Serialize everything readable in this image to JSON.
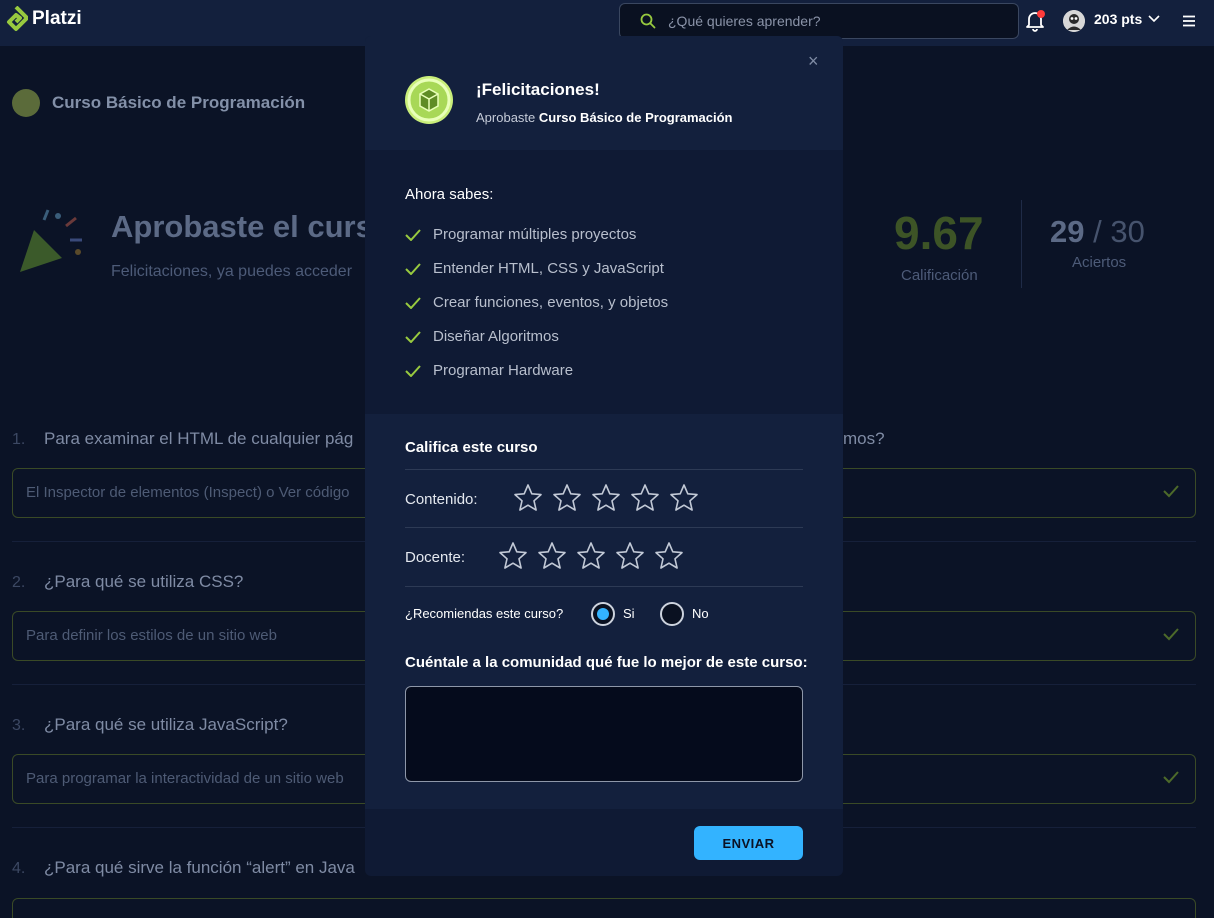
{
  "brand": {
    "name": "Platzi",
    "accent": "#98ca3f"
  },
  "search": {
    "placeholder": "¿Qué quieres aprender?"
  },
  "user": {
    "points": "203 pts"
  },
  "page": {
    "course_title": "Curso Básico de Programación",
    "approved_title": "Aprobaste el curso",
    "approved_sub": "Felicitaciones, ya puedes acceder",
    "score": "9.67",
    "score_label": "Calificación",
    "aciertos_value": "29",
    "aciertos_total": " / 30",
    "aciertos_label": "Aciertos",
    "questions": [
      {
        "num": "1.",
        "text": "Para examinar el HTML de cualquier pág",
        "text_right": "mos?",
        "answer": "El Inspector de elementos (Inspect) o Ver código"
      },
      {
        "num": "2.",
        "text": "¿Para qué se utiliza CSS?",
        "answer": "Para definir los estilos de un sitio web"
      },
      {
        "num": "3.",
        "text": "¿Para qué se utiliza JavaScript?",
        "answer": "Para programar la interactividad de un sitio web"
      },
      {
        "num": "4.",
        "text": "¿Para qué sirve la función “alert” en Java"
      }
    ]
  },
  "modal": {
    "close": "×",
    "title": "¡Felicitaciones!",
    "approved_prefix": "Aprobaste",
    "course_name": "Curso Básico de Programación",
    "skills_title": "Ahora sabes:",
    "skills": [
      "Programar múltiples proyectos",
      "Entender HTML, CSS y JavaScript",
      "Crear funciones, eventos, y objetos",
      "Diseñar Algoritmos",
      "Programar Hardware"
    ],
    "rate_title": "Califica este curso",
    "content_label": "Contenido:",
    "teacher_label": "Docente:",
    "content_rating": 0,
    "teacher_rating": 0,
    "recommend_label": "¿Recomiendas este curso?",
    "yes_label": "Si",
    "no_label": "No",
    "recommend_selected": "Si",
    "tell_label": "Cuéntale a la comunidad qué fue lo mejor de este curso:",
    "send_label": "ENVIAR"
  },
  "colors": {
    "page_bg": "#0b1326",
    "topbar": "#13203d",
    "check": "#98ca3f",
    "primary_button": "#33b3ff",
    "notification_dot": "#ff3b3b"
  }
}
